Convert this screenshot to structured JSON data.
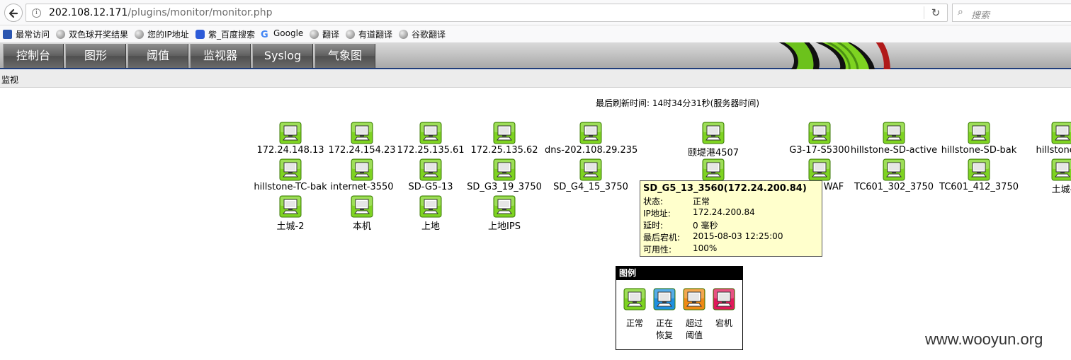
{
  "browser": {
    "url_host": "202.108.12.171",
    "url_path": "/plugins/monitor/monitor.php",
    "search_placeholder": "搜索"
  },
  "bookmarks": [
    "最常访问",
    "双色球开奖结果",
    "您的IP地址",
    "紫_百度搜索",
    "Google",
    "翻译",
    "有道翻译",
    "谷歌翻译"
  ],
  "nav": {
    "tabs": [
      "控制台",
      "图形",
      "阈值",
      "监视器",
      "Syslog",
      "气象图"
    ]
  },
  "subbar": {
    "title": "监视"
  },
  "refresh": {
    "text": "最后刷新时间: 14时34分31秒(服务器时间)"
  },
  "devices": {
    "row1": [
      "172.24.148.13",
      "172.24.154.23",
      "172.25.135.61",
      "172.25.135.62",
      "dns-202.108.29.235",
      "颐堤港4507",
      "G3-17-S5300",
      "hillstone-SD-active",
      "hillstone-SD-bak",
      "hillstone-TC"
    ],
    "row2": [
      "hillstone-TC-bak",
      "internet-3550",
      "SD-G5-13",
      "SD_G3_19_3750",
      "SD_G4_15_3750",
      "",
      "WAF",
      "TC601_302_3750",
      "TC601_412_3750",
      "土城-"
    ],
    "row3": [
      "土城-2",
      "本机",
      "上地",
      "上地IPS"
    ]
  },
  "tooltip": {
    "title": "SD_G5_13_3560(172.24.200.84)",
    "rows": [
      {
        "k": "状态:",
        "v": "正常"
      },
      {
        "k": "IP地址:",
        "v": "172.24.200.84"
      },
      {
        "k": "延时:",
        "v": "0 毫秒"
      },
      {
        "k": "最后宕机:",
        "v": "2015-08-03 12:25:00"
      },
      {
        "k": "可用性:",
        "v": "100%"
      }
    ]
  },
  "legend": {
    "title": "图例",
    "items": [
      {
        "line1": "正常",
        "line2": "",
        "color": "#7ed321"
      },
      {
        "line1": "正在",
        "line2": "恢复",
        "color": "#1e90e0"
      },
      {
        "line1": "超过",
        "line2": "阈值",
        "color": "#ef8a14"
      },
      {
        "line1": "宕机",
        "line2": "",
        "color": "#e0195a"
      }
    ]
  },
  "colors": {
    "normal": "#7ed321",
    "nav_line": "#1f3d7a"
  },
  "watermark": "www.wooyun.org"
}
